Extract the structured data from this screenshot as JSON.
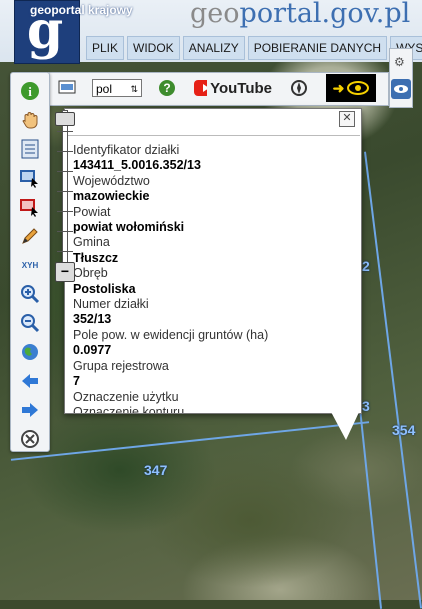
{
  "header": {
    "portal_title": "geoportal krajowy",
    "site_prefix": "geo",
    "site_rest": "portal.gov.pl",
    "menu": [
      "PLIK",
      "WIDOK",
      "ANALIZY",
      "POBIERANIE DANYCH",
      "WYS"
    ]
  },
  "toolbar": {
    "language": "pol",
    "youtube_label": "YouTube"
  },
  "left_tools": [
    "info-icon",
    "hand-icon",
    "list-icon",
    "select-rectangle-icon",
    "clear-selection-icon",
    "pencil-icon",
    "xyh-icon",
    "zoom-in-icon",
    "zoom-out-icon",
    "globe-icon",
    "arrow-back-icon",
    "arrow-forward-icon",
    "cancel-icon"
  ],
  "xyh_label": "XYH",
  "popup": {
    "fields": [
      {
        "label": "Identyfikator działki",
        "value": "143411_5.0016.352/13"
      },
      {
        "label": "Województwo",
        "value": "mazowieckie"
      },
      {
        "label": "Powiat",
        "value": "powiat wołomiński"
      },
      {
        "label": "Gmina",
        "value": "Tłuszcz"
      },
      {
        "label": "Obręb",
        "value": "Postoliska"
      },
      {
        "label": "Numer działki",
        "value": "352/13"
      },
      {
        "label": "Pole pow. w ewidencji gruntów (ha)",
        "value": "0.0977"
      },
      {
        "label": "Grupa rejestrowa",
        "value": "7"
      },
      {
        "label": "Oznaczenie użytku",
        "value": ""
      },
      {
        "label": "Oznaczenie konturu",
        "value": ""
      }
    ]
  },
  "map_labels": {
    "parcel_347": "347",
    "parcel_354": "354",
    "parcel_2": "2",
    "parcel_3": "3"
  },
  "colors": {
    "brand_blue": "#1e3f7c",
    "menu_bg": "#cfdfef",
    "parcel_line": "#6ea6e6"
  }
}
